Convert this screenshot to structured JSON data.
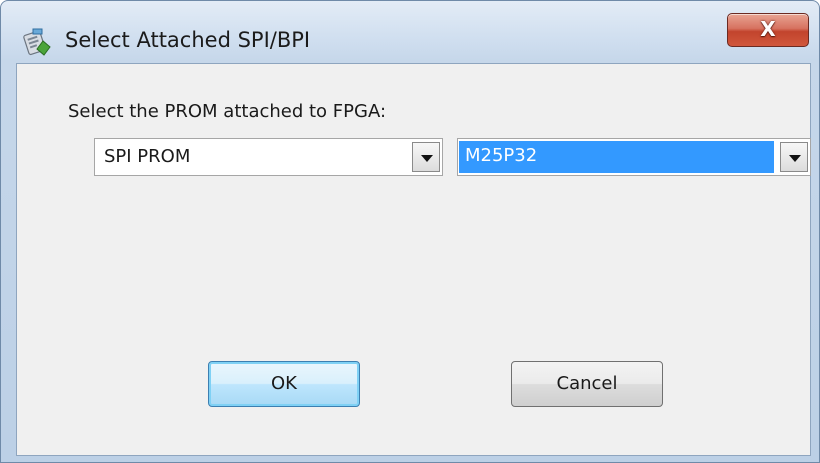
{
  "window": {
    "title": "Select Attached SPI/BPI",
    "close_label": "X"
  },
  "form": {
    "prompt": "Select the PROM attached to FPGA:",
    "prom_type": {
      "value": "SPI PROM"
    },
    "prom_device": {
      "value": "M25P32"
    }
  },
  "buttons": {
    "ok_label": "OK",
    "cancel_label": "Cancel"
  },
  "icons": {
    "title_icon": "app-device-icon",
    "close_icon": "close-icon",
    "dropdown_icon": "chevron-down-icon"
  },
  "colors": {
    "selection_highlight": "#3399ff",
    "close_button": "#c2442d"
  }
}
